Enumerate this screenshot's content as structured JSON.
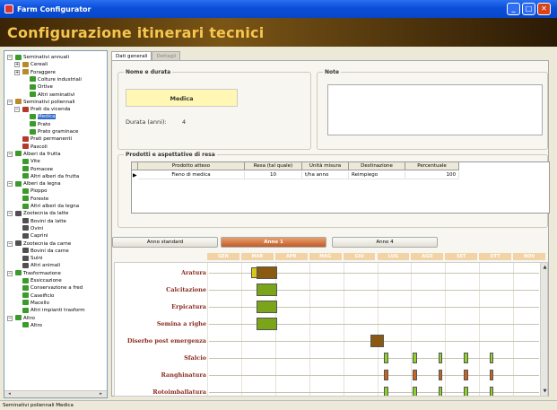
{
  "window": {
    "title": "Farm Configurator",
    "min_label": "_",
    "max_label": "□",
    "close_label": "✕"
  },
  "header": {
    "title": "Configurazione itinerari tecnici"
  },
  "tree": {
    "items": [
      {
        "label": "Seminativi annuali",
        "icon": "plant",
        "expander": "−"
      },
      {
        "label": "Cereali",
        "icon": "grain",
        "expander": "+"
      },
      {
        "label": "Foraggere",
        "icon": "grain",
        "expander": "+"
      },
      {
        "label": "Colture industriali",
        "icon": "plant"
      },
      {
        "label": "Ortive",
        "icon": "plant"
      },
      {
        "label": "Altri seminativi",
        "icon": "plant"
      },
      {
        "label": "Seminativi poliennali",
        "icon": "grain",
        "expander": "−"
      },
      {
        "label": "Prati da vicenda",
        "icon": "red",
        "expander": "−"
      },
      {
        "label": "Medica",
        "icon": "plant",
        "selected": true
      },
      {
        "label": "Prato",
        "icon": "plant"
      },
      {
        "label": "Prato graminace",
        "icon": "plant"
      },
      {
        "label": "Prati permanenti",
        "icon": "red"
      },
      {
        "label": "Pascoli",
        "icon": "red"
      },
      {
        "label": "Alberi da frutta",
        "icon": "plant",
        "expander": "−"
      },
      {
        "label": "Vite",
        "icon": "plant"
      },
      {
        "label": "Pomacee",
        "icon": "plant"
      },
      {
        "label": "Altri alberi da frutta",
        "icon": "plant"
      },
      {
        "label": "Alberi da legna",
        "icon": "plant",
        "expander": "−"
      },
      {
        "label": "Pioppo",
        "icon": "plant"
      },
      {
        "label": "Foreste",
        "icon": "plant"
      },
      {
        "label": "Altri alberi da legna",
        "icon": "plant"
      },
      {
        "label": "Zootecnia da latte",
        "icon": "cow",
        "expander": "−"
      },
      {
        "label": "Bovini da latte",
        "icon": "cow"
      },
      {
        "label": "Ovini",
        "icon": "cow"
      },
      {
        "label": "Caprini",
        "icon": "cow"
      },
      {
        "label": "Zootecnia da carne",
        "icon": "cow",
        "expander": "−"
      },
      {
        "label": "Bovini da carne",
        "icon": "cow"
      },
      {
        "label": "Suini",
        "icon": "cow"
      },
      {
        "label": "Altri animali",
        "icon": "cow"
      },
      {
        "label": "Trasformazione",
        "icon": "plant",
        "expander": "−"
      },
      {
        "label": "Essiccazione",
        "icon": "plant"
      },
      {
        "label": "Conservazione a fred",
        "icon": "plant"
      },
      {
        "label": "Caseificio",
        "icon": "plant"
      },
      {
        "label": "Macello",
        "icon": "plant"
      },
      {
        "label": "Altri impianti trasform",
        "icon": "plant"
      },
      {
        "label": "Altro",
        "icon": "plant",
        "expander": "−"
      },
      {
        "label": "Altro",
        "icon": "plant"
      }
    ]
  },
  "tabs": [
    {
      "label": "Dati generali",
      "active": true
    },
    {
      "label": "Dettagli",
      "active": false
    }
  ],
  "nome_durata": {
    "group_label": "Nome e durata",
    "name_value": "Medica",
    "durata_label": "Durata (anni):",
    "durata_value": "4"
  },
  "note": {
    "group_label": "Note",
    "value": ""
  },
  "prodotti": {
    "group_label": "Prodotti e aspettative di resa",
    "columns": [
      "Prodotto atteso",
      "Resa (tal quale)",
      "Unità misura",
      "Destinazione",
      "Percentuale"
    ],
    "rows": [
      [
        "Fieno di medica",
        "10",
        "t/ha anno",
        "Reimpiego",
        "100"
      ]
    ],
    "row_marker": "▶"
  },
  "year_buttons": [
    "Anno standard",
    "Anno 1",
    "Anno 4"
  ],
  "active_year": "Anno 1",
  "months": [
    "GEN",
    "MAR",
    "APR",
    "MAG",
    "GIU",
    "LUG",
    "AGO",
    "SET",
    "OTT",
    "NOV"
  ],
  "operations": [
    "Aratura",
    "Calcitazione",
    "Erpicatura",
    "Semina a righe",
    "Diserbo post emergenza",
    "Sfalcio",
    "Ranghinatura",
    "Rotoimballatura"
  ],
  "colors": {
    "green": "#7aa51a",
    "orange": "#c8621e",
    "brown": "#8b5a12",
    "yellow": "#d8c81a",
    "lime": "#8fd12a"
  },
  "schedule": [
    {
      "op": "Aratura",
      "marks": [
        {
          "month": 1.3,
          "color": "yellow",
          "w": 0.25
        },
        {
          "month": 1.45,
          "color": "brown",
          "w": 0.6
        }
      ]
    },
    {
      "op": "Calcitazione",
      "marks": [
        {
          "month": 1.45,
          "color": "green",
          "w": 0.6
        }
      ]
    },
    {
      "op": "Erpicatura",
      "marks": [
        {
          "month": 1.45,
          "color": "green",
          "w": 0.6
        }
      ]
    },
    {
      "op": "Semina a righe",
      "marks": [
        {
          "month": 1.45,
          "color": "green",
          "w": 0.6
        }
      ]
    },
    {
      "op": "Diserbo post emergenza",
      "marks": [
        {
          "month": 4.8,
          "color": "brown",
          "w": 0.4
        }
      ]
    },
    {
      "op": "Sfalcio",
      "marks": [
        {
          "month": 5.2,
          "color": "lime",
          "w": 0.12
        },
        {
          "month": 6.05,
          "color": "lime",
          "w": 0.12
        },
        {
          "month": 6.8,
          "color": "lime",
          "w": 0.12
        },
        {
          "month": 7.55,
          "color": "lime",
          "w": 0.12
        },
        {
          "month": 8.3,
          "color": "lime",
          "w": 0.12
        }
      ]
    },
    {
      "op": "Ranghinatura",
      "marks": [
        {
          "month": 5.2,
          "color": "orange",
          "w": 0.12
        },
        {
          "month": 6.05,
          "color": "orange",
          "w": 0.12
        },
        {
          "month": 6.8,
          "color": "orange",
          "w": 0.12
        },
        {
          "month": 7.55,
          "color": "orange",
          "w": 0.12
        },
        {
          "month": 8.3,
          "color": "orange",
          "w": 0.12
        }
      ]
    },
    {
      "op": "Rotoimballatura",
      "marks": [
        {
          "month": 5.2,
          "color": "lime",
          "w": 0.12
        },
        {
          "month": 6.05,
          "color": "lime",
          "w": 0.12
        },
        {
          "month": 6.8,
          "color": "lime",
          "w": 0.12
        },
        {
          "month": 7.55,
          "color": "lime",
          "w": 0.12
        },
        {
          "month": 8.3,
          "color": "lime",
          "w": 0.12
        }
      ]
    }
  ],
  "status": {
    "text": "Seminativi poliennali Medica"
  },
  "icons": {
    "app": "app-icon",
    "tree_scroll_left": "◂",
    "tree_scroll_right": "▸",
    "scroll_up": "▲",
    "scroll_down": "▼"
  }
}
